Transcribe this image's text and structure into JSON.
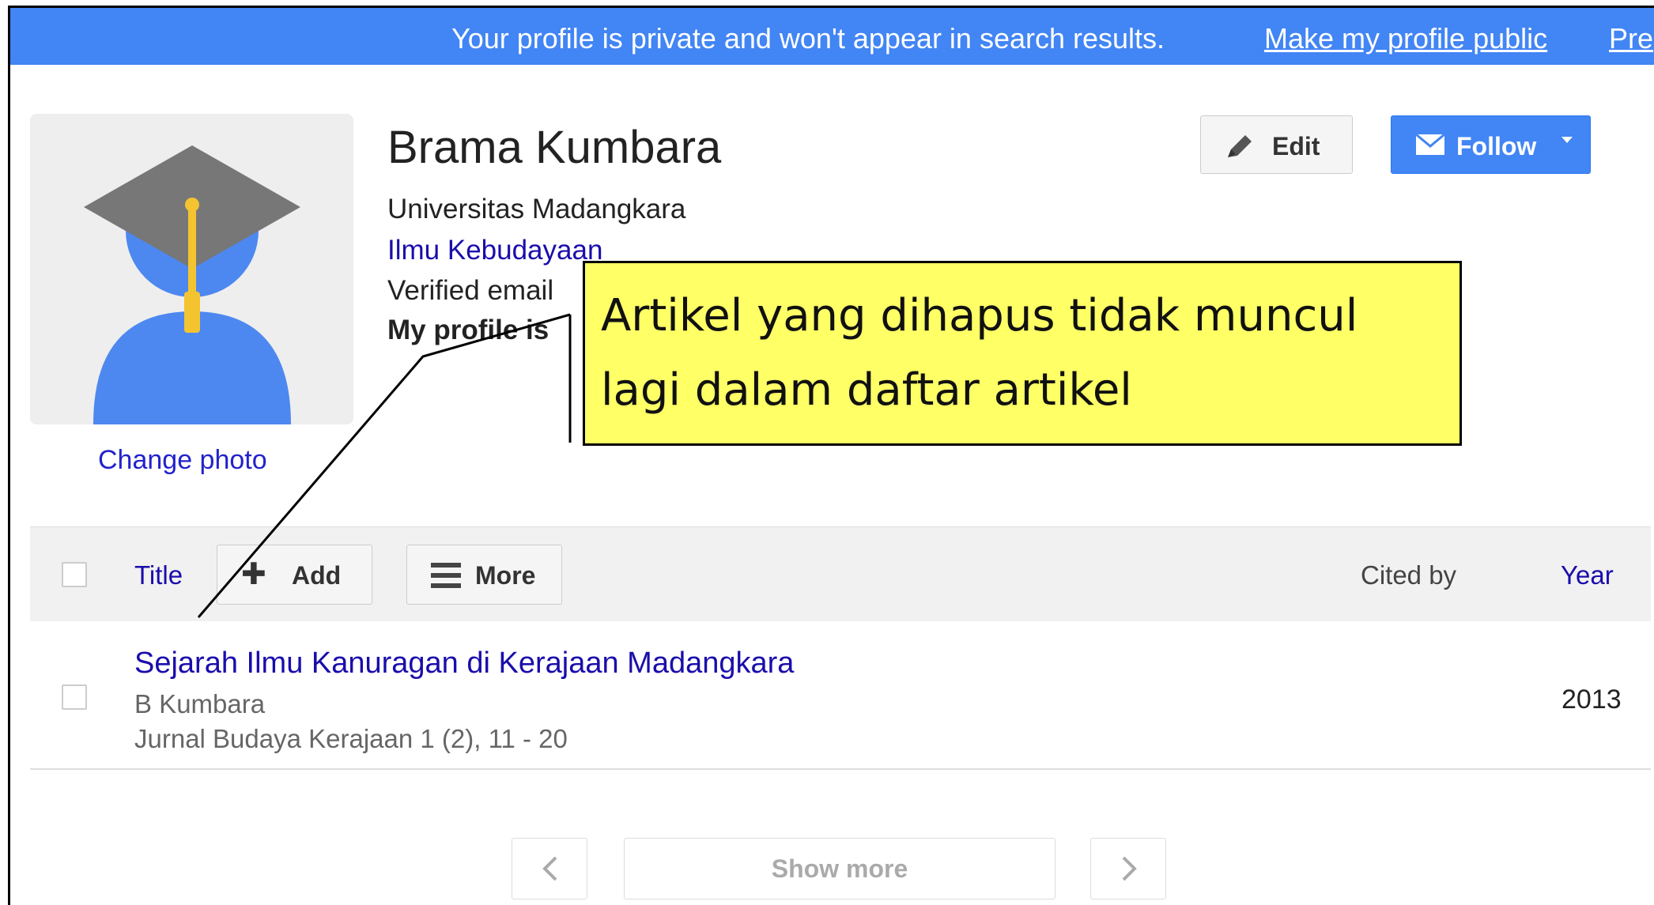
{
  "banner": {
    "message": "Your profile is private and won't appear in search results.",
    "make_public_link": "Make my profile public",
    "preview_link": "Pre"
  },
  "profile": {
    "name": "Brama Kumbara",
    "affiliation": "Universitas Madangkara",
    "field": "Ilmu Kebudayaan",
    "verified_email": "Verified email",
    "profile_state": "My profile is",
    "change_photo": "Change photo"
  },
  "actions": {
    "edit_label": "Edit",
    "follow_label": "Follow"
  },
  "table": {
    "title_header": "Title",
    "add_label": "Add",
    "more_label": "More",
    "cited_by_header": "Cited by",
    "year_header": "Year",
    "articles": [
      {
        "title": "Sejarah Ilmu Kanuragan di Kerajaan Madangkara",
        "authors": "B Kumbara",
        "venue": "Jurnal Budaya Kerajaan 1 (2), 11 - 20",
        "year": "2013"
      }
    ]
  },
  "pagination": {
    "show_more": "Show more"
  },
  "annotation": {
    "line1": "Artikel yang dihapus tidak muncul",
    "line2": "lagi dalam daftar artikel"
  },
  "colors": {
    "banner": "#4285f4",
    "link": "#1a0dab",
    "callout": "#ffff66"
  }
}
